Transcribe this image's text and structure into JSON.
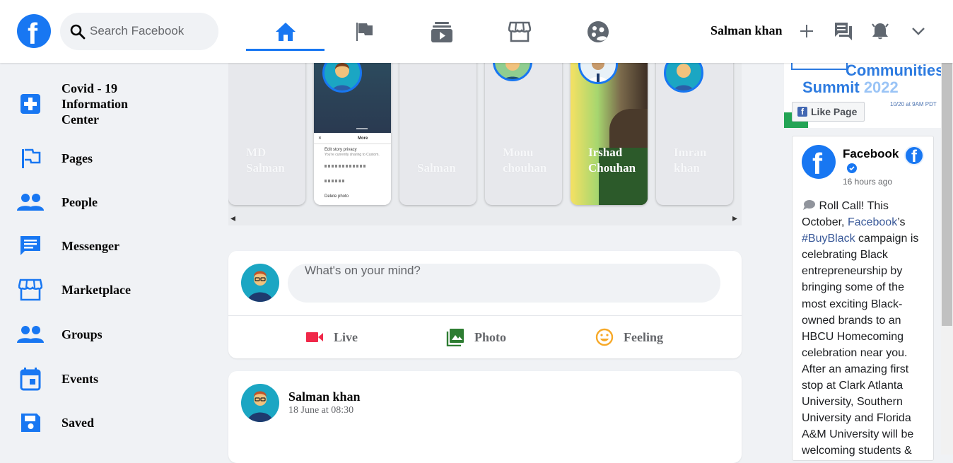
{
  "header": {
    "logo_letter": "f",
    "search_placeholder": "Search Facebook",
    "nav_tabs": [
      "home-icon",
      "flag-icon",
      "watch-icon",
      "marketplace-icon",
      "groups-icon"
    ],
    "active_tab": "home-icon",
    "user_name": "Salman khan",
    "accent_color": "#1877f2"
  },
  "sidebar": {
    "items": [
      {
        "label": "Covid - 19 Information Center",
        "icon": "covid-info-icon"
      },
      {
        "label": "Pages",
        "icon": "pages-flag-icon"
      },
      {
        "label": "People",
        "icon": "people-icon"
      },
      {
        "label": "Messenger",
        "icon": "messenger-icon"
      },
      {
        "label": "Marketplace",
        "icon": "marketplace-icon"
      },
      {
        "label": "Groups",
        "icon": "groups-icon"
      },
      {
        "label": "Events",
        "icon": "events-icon"
      },
      {
        "label": "Saved",
        "icon": "saved-icon"
      }
    ]
  },
  "stories": {
    "items": [
      {
        "line1": "MD",
        "line2": "Salman"
      },
      {
        "menu_title": "More",
        "menu_item_1": "Edit story privacy",
        "menu_item_1_sub": "You're currently sharing to Custom.",
        "menu_item_4": "Delete photo"
      },
      {
        "line1": "",
        "line2": "Salman"
      },
      {
        "line1": "Monu",
        "line2": "chouhan"
      },
      {
        "line1": "Irshad",
        "line2": "Chouhan"
      },
      {
        "line1": "Imran",
        "line2": "khan"
      }
    ]
  },
  "composer": {
    "placeholder": "What's on your mind?",
    "actions": [
      {
        "label": "Live",
        "icon": "live-video-icon",
        "color": "#f02849"
      },
      {
        "label": "Photo",
        "icon": "photo-icon",
        "color": "#45bd62"
      },
      {
        "label": "Feeling",
        "icon": "feeling-icon",
        "color": "#f7b928"
      }
    ]
  },
  "post": {
    "author": "Salman khan",
    "time": "18 June at 08:30"
  },
  "right": {
    "banner_line1": "Communities",
    "banner_line2a": "Summit",
    "banner_line2b": "2022",
    "banner_line3": "10/20 at 9AM PDT",
    "like_page_label": "Like Page",
    "page_name": "Facebook",
    "page_time": "16 hours ago",
    "body_1": "Roll Call! This October,",
    "body_link1": "Facebook",
    "body_2": "’s",
    "body_link2": "#BuyBlack",
    "body_3": "campaign is celebrating Black entrepreneurship by bringing some of the most exciting Black-owned brands to an HBCU Homecoming celebration near you. After an amazing first stop at Clark Atlanta University, Southern University and Florida A&M University will be welcoming students &"
  }
}
